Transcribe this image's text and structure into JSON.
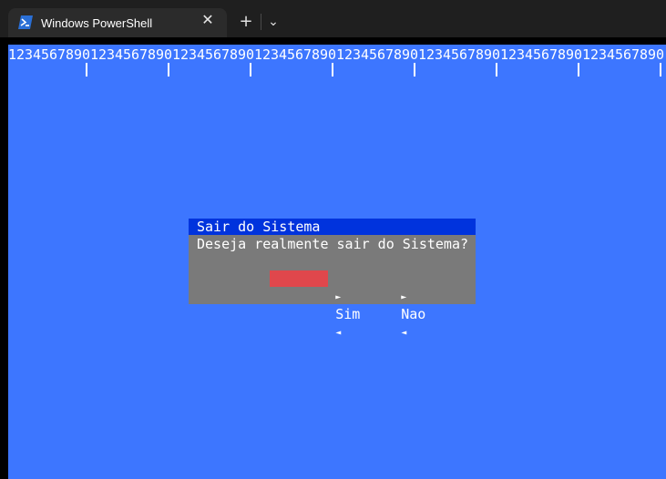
{
  "window": {
    "tab_title": "Windows PowerShell",
    "tab_close": "✕",
    "new_tab": "+",
    "dropdown": "⌄"
  },
  "terminal": {
    "ruler": "12345678901234567890123456789012345678901234567890123456789012345678901234567890",
    "background": "#3d76ff"
  },
  "dialog": {
    "title": "Sair do Sistema",
    "message": "Deseja realmente sair do Sistema?",
    "yes_button": {
      "label": "Sim",
      "selected": true
    },
    "no_button": {
      "label": "Nao",
      "selected": false
    },
    "arrow_left": "►",
    "arrow_right": "◄",
    "colors": {
      "title_bg": "#0033dd",
      "body_bg": "#7a7a7a",
      "selected_bg": "#e0474c"
    }
  }
}
